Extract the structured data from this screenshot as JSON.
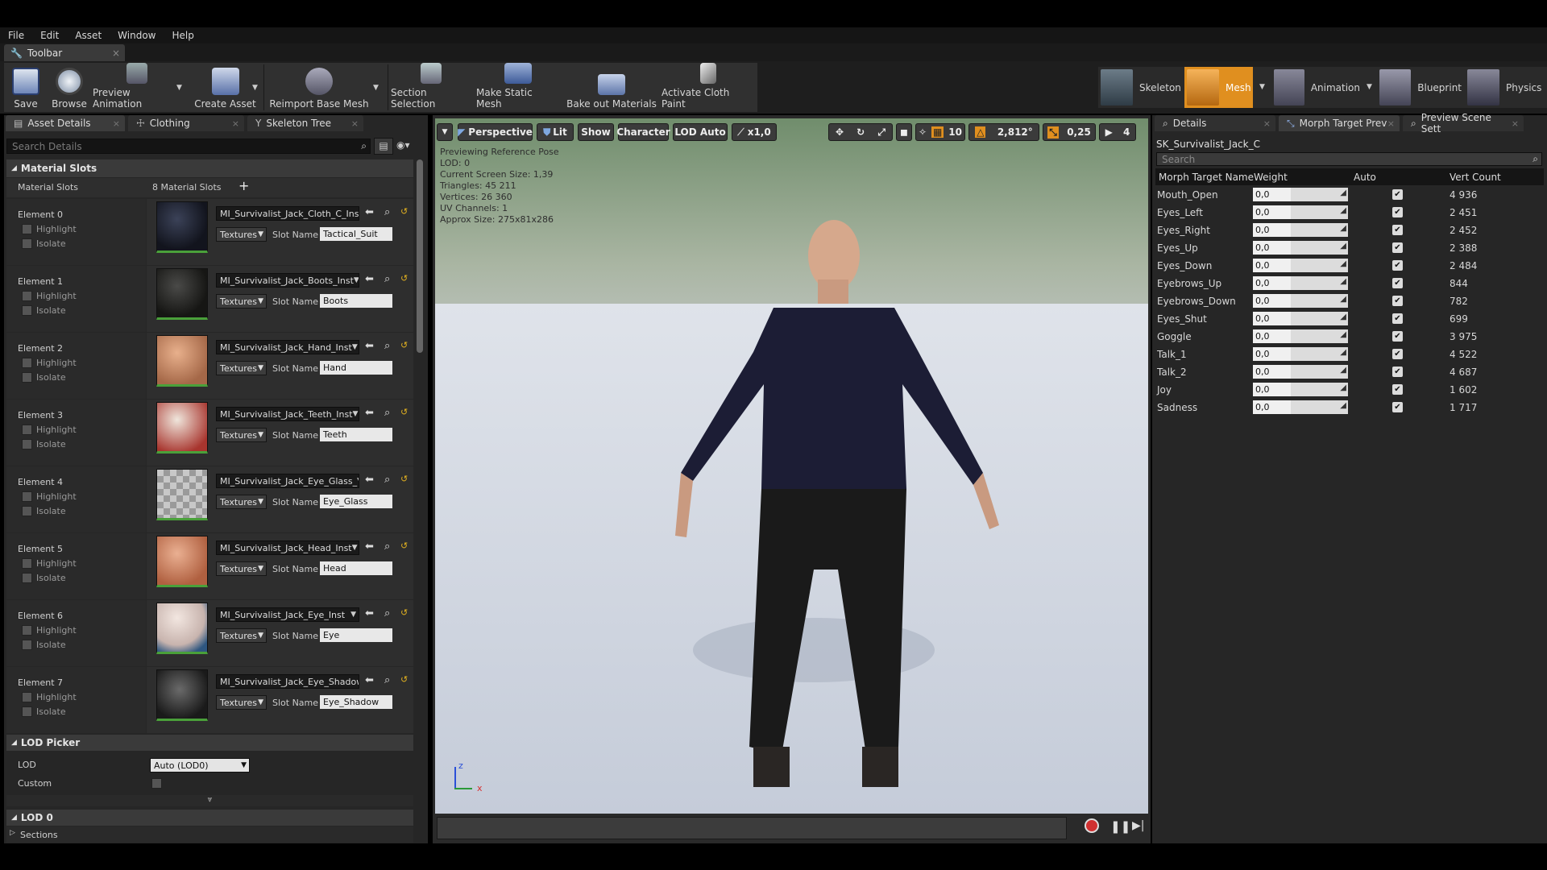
{
  "menu": [
    "File",
    "Edit",
    "Asset",
    "Window",
    "Help"
  ],
  "toolbar_tab": {
    "label": "Toolbar"
  },
  "toolbar": {
    "save": "Save",
    "browse": "Browse",
    "preview_animation": "Preview Animation",
    "create_asset": "Create Asset",
    "reimport": "Reimport Base Mesh",
    "section_selection": "Section Selection",
    "make_static_mesh": "Make Static Mesh",
    "bake_out": "Bake out Materials",
    "cloth_paint": "Activate Cloth Paint"
  },
  "modes": {
    "skeleton": "Skeleton",
    "mesh": "Mesh",
    "animation": "Animation",
    "blueprint": "Blueprint",
    "physics": "Physics"
  },
  "left": {
    "tabs": [
      "Asset Details",
      "Clothing",
      "Skeleton Tree"
    ],
    "search_placeholder": "Search Details",
    "material_slots_header": "Material Slots",
    "material_slots_label": "Material Slots",
    "material_slots_count": "8 Material Slots",
    "highlight": "Highlight",
    "isolate": "Isolate",
    "textures": "Textures",
    "slot_name_label": "Slot Name",
    "elements": [
      {
        "label": "Element 0",
        "material": "MI_Survivalist_Jack_Cloth_C_Inst",
        "slot": "Tactical_Suit"
      },
      {
        "label": "Element 1",
        "material": "MI_Survivalist_Jack_Boots_Inst",
        "slot": "Boots"
      },
      {
        "label": "Element 2",
        "material": "MI_Survivalist_Jack_Hand_Inst",
        "slot": "Hand"
      },
      {
        "label": "Element 3",
        "material": "MI_Survivalist_Jack_Teeth_Inst",
        "slot": "Teeth"
      },
      {
        "label": "Element 4",
        "material": "MI_Survivalist_Jack_Eye_Glass_",
        "slot": "Eye_Glass"
      },
      {
        "label": "Element 5",
        "material": "MI_Survivalist_Jack_Head_Inst",
        "slot": "Head"
      },
      {
        "label": "Element 6",
        "material": "MI_Survivalist_Jack_Eye_Inst",
        "slot": "Eye"
      },
      {
        "label": "Element 7",
        "material": "MI_Survivalist_Jack_Eye_Shadow",
        "slot": "Eye_Shadow"
      }
    ],
    "lod_picker_header": "LOD Picker",
    "lod_label": "LOD",
    "lod_value": "Auto (LOD0)",
    "custom_label": "Custom",
    "lod0_header": "LOD 0",
    "sections_label": "Sections"
  },
  "viewport": {
    "perspective": "Perspective",
    "lit": "Lit",
    "show": "Show",
    "character": "Character",
    "lod_auto": "LOD Auto",
    "speed": "x1,0",
    "grid": "10",
    "angle": "2,812°",
    "scale": "0,25",
    "cam": "4",
    "info": [
      "Previewing Reference Pose",
      "LOD: 0",
      "Current Screen Size: 1,39",
      "Triangles: 45 211",
      "Vertices: 26 360",
      "UV Channels: 1",
      "Approx Size: 275x81x286"
    ],
    "axis_z": "z",
    "axis_x": "x"
  },
  "right": {
    "tabs": [
      "Details",
      "Morph Target Prev",
      "Preview Scene Sett"
    ],
    "asset_name": "SK_Survivalist_Jack_C",
    "search_placeholder": "Search",
    "columns": [
      "Morph Target Name",
      "Weight",
      "Auto",
      "Vert Count"
    ],
    "rows": [
      {
        "name": "Mouth_Open",
        "weight": "0,0",
        "count": "4 936"
      },
      {
        "name": "Eyes_Left",
        "weight": "0,0",
        "count": "2 451"
      },
      {
        "name": "Eyes_Right",
        "weight": "0,0",
        "count": "2 452"
      },
      {
        "name": "Eyes_Up",
        "weight": "0,0",
        "count": "2 388"
      },
      {
        "name": "Eyes_Down",
        "weight": "0,0",
        "count": "2 484"
      },
      {
        "name": "Eyebrows_Up",
        "weight": "0,0",
        "count": "844"
      },
      {
        "name": "Eyebrows_Down",
        "weight": "0,0",
        "count": "782"
      },
      {
        "name": "Eyes_Shut",
        "weight": "0,0",
        "count": "699"
      },
      {
        "name": "Goggle",
        "weight": "0,0",
        "count": "3 975"
      },
      {
        "name": "Talk_1",
        "weight": "0,0",
        "count": "4 522"
      },
      {
        "name": "Talk_2",
        "weight": "0,0",
        "count": "4 687"
      },
      {
        "name": "Joy",
        "weight": "0,0",
        "count": "1 602"
      },
      {
        "name": "Sadness",
        "weight": "0,0",
        "count": "1 717"
      }
    ]
  },
  "icons": {
    "check": "✔",
    "arrow_left": "⬅",
    "search": "⌕",
    "dropdown": "▾",
    "triangle_down": "◢",
    "plus": "+"
  },
  "colors": {
    "accent": "#e08f1f",
    "panel": "#262626",
    "thumb_border": "#4aa03a"
  }
}
